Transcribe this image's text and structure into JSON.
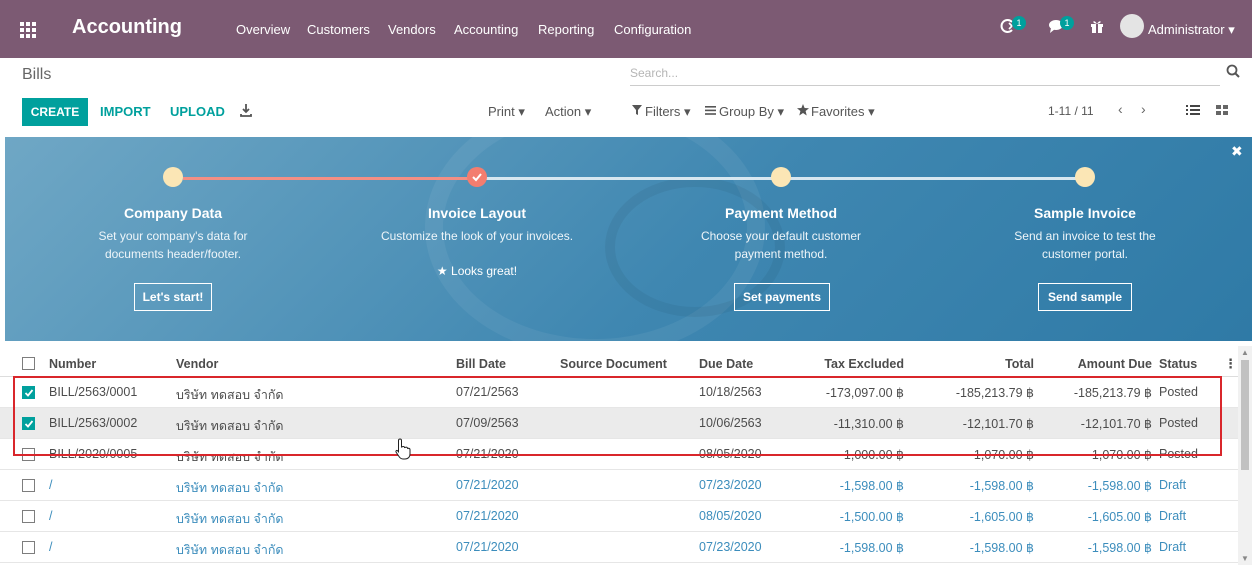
{
  "navbar": {
    "app_title": "Accounting",
    "menu": [
      "Overview",
      "Customers",
      "Vendors",
      "Accounting",
      "Reporting",
      "Configuration"
    ],
    "activity_badge": "1",
    "messages_badge": "1",
    "user": "Administrator ▾"
  },
  "control": {
    "title": "Bills",
    "search_placeholder": "Search...",
    "create": "CREATE",
    "import": "IMPORT",
    "upload": "UPLOAD",
    "print": "Print ▾",
    "action": "Action ▾",
    "filters": "Filters ▾",
    "group_by": "Group By ▾",
    "favorites": "Favorites ▾",
    "pager": "1-11 / 11"
  },
  "banner": {
    "steps": [
      {
        "title": "Company Data",
        "desc1": "Set your company's data for",
        "desc2": "documents header/footer.",
        "button": "Let's start!"
      },
      {
        "title": "Invoice Layout",
        "desc1": "Customize the look of your invoices.",
        "desc2": "",
        "note": "Looks great!"
      },
      {
        "title": "Payment Method",
        "desc1": "Choose your default customer",
        "desc2": "payment method.",
        "button": "Set payments"
      },
      {
        "title": "Sample Invoice",
        "desc1": "Send an invoice to test the",
        "desc2": "customer portal.",
        "button": "Send sample"
      }
    ]
  },
  "table": {
    "columns": [
      "Number",
      "Vendor",
      "Bill Date",
      "Source Document",
      "Due Date",
      "Tax Excluded",
      "Total",
      "Amount Due",
      "Status"
    ],
    "rows": [
      {
        "number": "BILL/2563/0001",
        "vendor": "บริษัท ทดสอบ จำกัด",
        "bill_date": "07/21/2563",
        "due_date": "10/18/2563",
        "tax_excluded": "-173,097.00 ฿",
        "total": "-185,213.79 ฿",
        "amount_due": "-185,213.79 ฿",
        "status": "Posted",
        "checked": true
      },
      {
        "number": "BILL/2563/0002",
        "vendor": "บริษัท ทดสอบ จำกัด",
        "bill_date": "07/09/2563",
        "due_date": "10/06/2563",
        "tax_excluded": "-11,310.00 ฿",
        "total": "-12,101.70 ฿",
        "amount_due": "-12,101.70 ฿",
        "status": "Posted",
        "checked": true
      },
      {
        "number": "BILL/2020/0005",
        "vendor": "บริษัท ทดสอบ จำกัด",
        "bill_date": "07/21/2020",
        "due_date": "08/05/2020",
        "tax_excluded": "-1,000.00 ฿",
        "total": "-1,070.00 ฿",
        "amount_due": "-1,070.00 ฿",
        "status": "Posted",
        "checked": false
      },
      {
        "number": "/",
        "vendor": "บริษัท ทดสอบ จำกัด",
        "bill_date": "07/21/2020",
        "due_date": "07/23/2020",
        "tax_excluded": "-1,598.00 ฿",
        "total": "-1,598.00 ฿",
        "amount_due": "-1,598.00 ฿",
        "status": "Draft",
        "checked": false
      },
      {
        "number": "/",
        "vendor": "บริษัท ทดสอบ จำกัด",
        "bill_date": "07/21/2020",
        "due_date": "08/05/2020",
        "tax_excluded": "-1,500.00 ฿",
        "total": "-1,605.00 ฿",
        "amount_due": "-1,605.00 ฿",
        "status": "Draft",
        "checked": false
      },
      {
        "number": "/",
        "vendor": "บริษัท ทดสอบ จำกัด",
        "bill_date": "07/21/2020",
        "due_date": "07/23/2020",
        "tax_excluded": "-1,598.00 ฿",
        "total": "-1,598.00 ฿",
        "amount_due": "-1,598.00 ฿",
        "status": "Draft",
        "checked": false
      }
    ]
  },
  "colors": {
    "navbar": "#7c5a73",
    "accent": "#00a09d",
    "highlight": "#d9262b",
    "draft_link": "#3c8dbc"
  },
  "icons": [
    "app-menu-icon",
    "activity-icon",
    "messages-icon",
    "gift-icon",
    "search-icon",
    "download-icon",
    "filter-icon",
    "group-by-icon",
    "star-icon",
    "list-view-icon",
    "kanban-view-icon",
    "close-icon",
    "checkmark-icon",
    "pointer-cursor-icon"
  ]
}
